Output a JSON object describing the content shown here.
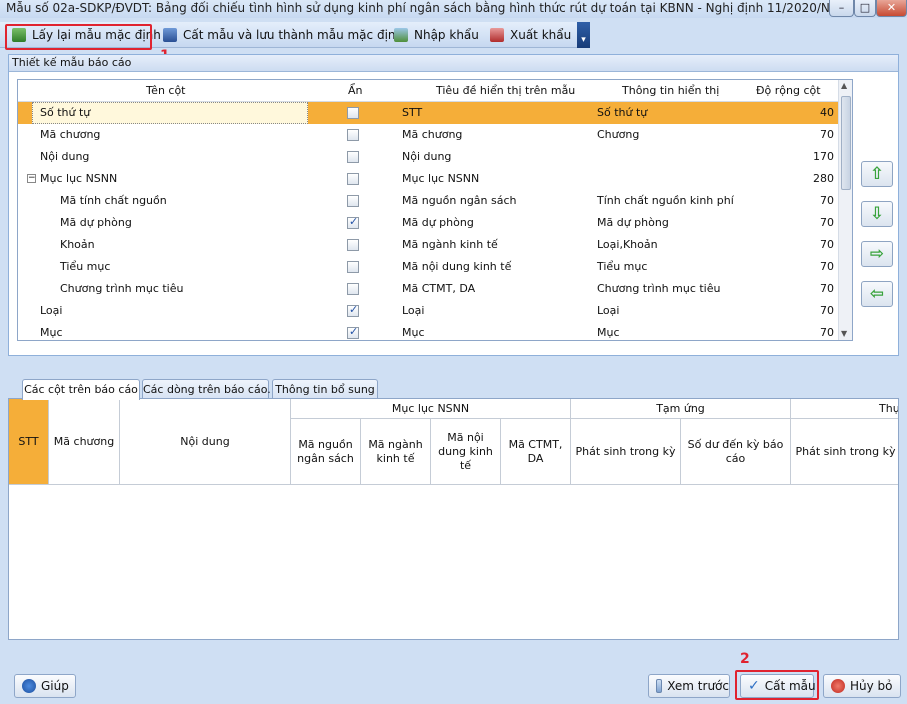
{
  "window": {
    "title": "Mẫu số 02a-SDKP/ĐVDT: Bảng đối chiếu tình hình sử dụng kinh phí ngân sách bằng hình thức rút dự toán tại KBNN - Nghị định 11/2020/NĐ-CP (M...",
    "min": "–",
    "max": "□",
    "close": "✕"
  },
  "toolbar": {
    "reset_label": "Lấy lại mẫu mặc định",
    "save_default_label": "Cất mẫu và lưu thành mẫu mặc định",
    "import_label": "Nhập khẩu",
    "export_label": "Xuất khẩu",
    "more": "▾"
  },
  "annotations": {
    "n1": "1",
    "n2": "2"
  },
  "design_panel": {
    "title": "Thiết kế mẫu báo cáo",
    "columns": [
      "Tên cột",
      "Ẩn",
      "Tiêu đề hiển thị trên mẫu",
      "Thông tin hiển thị",
      "Độ rộng cột"
    ],
    "rows": [
      {
        "name": "Số thứ tự",
        "level": 0,
        "hidden": false,
        "title": "STT",
        "info": "Số thứ tự",
        "width": "40"
      },
      {
        "name": "Mã chương",
        "level": 0,
        "hidden": false,
        "title": "Mã chương",
        "info": "Chương",
        "width": "70"
      },
      {
        "name": "Nội dung",
        "level": 0,
        "hidden": false,
        "title": "Nội dung",
        "info": "",
        "width": "170"
      },
      {
        "name": "Mục lục NSNN",
        "level": 0,
        "group": true,
        "toggle": "−",
        "hidden": false,
        "title": "Mục lục NSNN",
        "info": "",
        "width": "280"
      },
      {
        "name": "Mã tính chất nguồn",
        "level": 1,
        "hidden": false,
        "title": "Mã nguồn ngân sách",
        "info": "Tính chất nguồn kinh phí",
        "width": "70"
      },
      {
        "name": "Mã dự phòng",
        "level": 1,
        "hidden": true,
        "title": "Mã dự phòng",
        "info": "Mã dự phòng",
        "width": "70"
      },
      {
        "name": "Khoản",
        "level": 1,
        "hidden": false,
        "title": "Mã ngành kinh tế",
        "info": "Loại,Khoản",
        "width": "70"
      },
      {
        "name": "Tiểu mục",
        "level": 1,
        "hidden": false,
        "title": "Mã nội dung kinh tế",
        "info": "Tiểu mục",
        "width": "70"
      },
      {
        "name": "Chương trình mục tiêu",
        "level": 1,
        "hidden": false,
        "title": "Mã CTMT, DA",
        "info": "Chương trình mục tiêu",
        "width": "70"
      },
      {
        "name": "Loại",
        "level": 0,
        "hidden": true,
        "title": "Loại",
        "info": "Loại",
        "width": "70"
      },
      {
        "name": "Mục",
        "level": 0,
        "hidden": true,
        "title": "Mục",
        "info": "Mục",
        "width": "70"
      }
    ],
    "move_buttons": [
      "⇧",
      "⇩",
      "⇨",
      "⇦"
    ]
  },
  "tabs": [
    "Các cột trên báo cáo",
    "Các dòng trên báo cáo.",
    "Thông tin bổ sung"
  ],
  "preview": {
    "stt": "STT",
    "ma_chuong": "Mã chương",
    "noi_dung": "Nội dung",
    "group_mlns": "Mục lục NSNN",
    "group_tam_ung": "Tạm ứng",
    "group_thuc": "Thự",
    "sub": [
      "Mã nguồn ngân sách",
      "Mã ngành kinh tế",
      "Mã nội dung kinh tế",
      "Mã CTMT, DA",
      "Phát sinh trong kỳ",
      "Số dư đến kỳ báo cáo",
      "Phát sinh trong kỳ"
    ]
  },
  "footer": {
    "help": "Giúp",
    "preview": "Xem trước",
    "save": "Cất mẫu",
    "cancel": "Hủy bỏ"
  },
  "colors": {
    "selected_row": "#f5ae39",
    "annotation": "#e0232f"
  }
}
